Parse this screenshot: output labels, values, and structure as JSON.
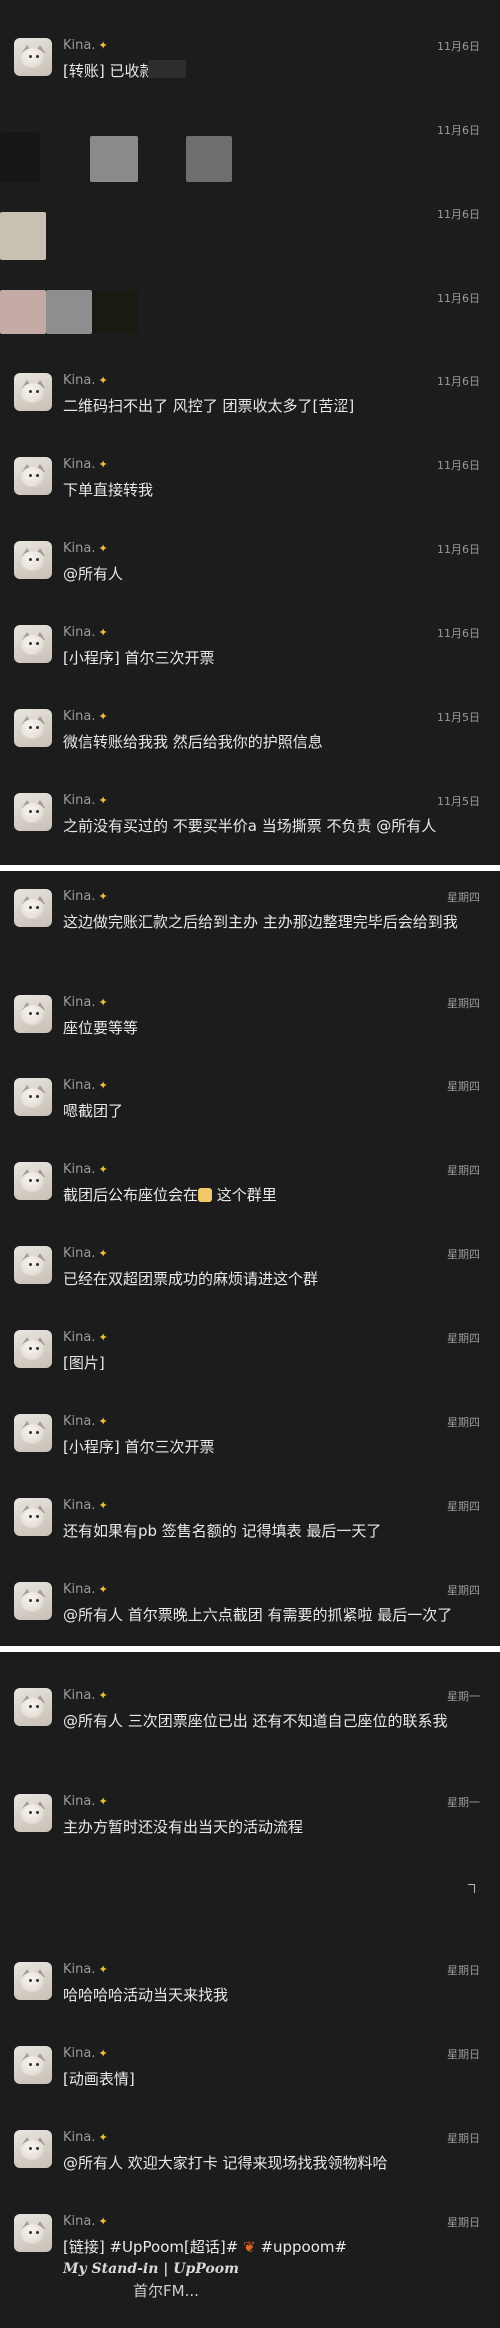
{
  "sender": "Kina.",
  "badge_icon": "sparkle-icon",
  "panel1": {
    "messages": [
      {
        "time": "11月6日",
        "text": "[转账] 已收款"
      },
      {
        "time": "11月6日",
        "text": ""
      },
      {
        "time": "11月6日",
        "text": ""
      },
      {
        "time": "11月6日",
        "text": ""
      },
      {
        "time": "11月6日",
        "text": "二维码扫不出了 风控了 团票收太多了[苦涩]"
      },
      {
        "time": "11月6日",
        "text": "下单直接转我"
      },
      {
        "time": "11月6日",
        "text": "@所有人"
      },
      {
        "time": "11月6日",
        "text": "[小程序] 首尔三次开票"
      },
      {
        "time": "11月5日",
        "text": "微信转账给我我 然后给我你的护照信息"
      },
      {
        "time": "11月5日",
        "text": "之前没有买过的 不要买半价a 当场撕票 不负责 @所有人"
      }
    ]
  },
  "panel2": {
    "messages": [
      {
        "time": "星期四",
        "text": "这边做完账汇款之后给到主办 主办那边整理完毕后会给到我"
      },
      {
        "time": "星期四",
        "text": "座位要等等"
      },
      {
        "time": "星期四",
        "text": "嗯截团了"
      },
      {
        "time": "星期四",
        "text_before": "截团后公布座位会在",
        "text_after": "这个群里"
      },
      {
        "time": "星期四",
        "text": "已经在双超团票成功的麻烦请进这个群"
      },
      {
        "time": "星期四",
        "text": "[图片]"
      },
      {
        "time": "星期四",
        "text": "[小程序] 首尔三次开票"
      },
      {
        "time": "星期四",
        "text": "还有如果有pb 签售名额的 记得填表 最后一天了"
      },
      {
        "time": "星期四",
        "text": "@所有人 首尔票晚上六点截团 有需要的抓紧啦 最后一次了"
      }
    ]
  },
  "panel3": {
    "messages": [
      {
        "time": "星期一",
        "text": "@所有人 三次团票座位已出 还有不知道自己座位的联系我"
      },
      {
        "time": "星期一",
        "text": "主办方暂时还没有出当天的活动流程"
      },
      {
        "time": "星期日",
        "text": "哈哈哈哈活动当天来找我"
      },
      {
        "time": "星期日",
        "text": "[动画表情]"
      },
      {
        "time": "星期日",
        "text": "@所有人 欢迎大家打卡 记得来现场找我领物料哈"
      },
      {
        "time": "星期日",
        "link_before": "[链接] #UpPoom[超话]#",
        "link_after": "#uppoom#",
        "link_line2": "My Stand-in | UpPoom",
        "link_line3": "首尔FM..."
      }
    ]
  },
  "colors": {
    "background": "#1c1c1c",
    "text": "#e8e8e8",
    "meta": "#9a9a9a",
    "separator": "#ffffff"
  }
}
